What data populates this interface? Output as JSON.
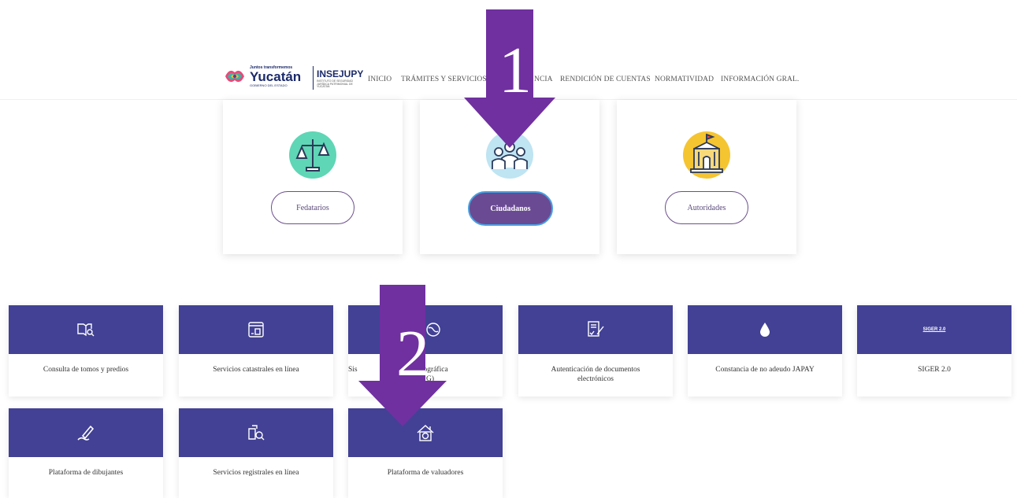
{
  "header": {
    "logo": {
      "tagline": "Juntos transformemos",
      "name": "Yucatán",
      "subtitle": "GOBIERNO DEL ESTADO",
      "org": "INSEJUPY",
      "org_subtitle": "INSTITUTO DE SEGURIDAD JURÍDICA PATRIMONIAL DE YUCATÁN"
    },
    "nav": [
      {
        "label": "INICIO"
      },
      {
        "label": "TRÁMITES Y SERVICIOS"
      },
      {
        "label": "NCIA"
      },
      {
        "label": "RENDICIÓN DE CUENTAS"
      },
      {
        "label": "NORMATIVIDAD"
      },
      {
        "label": "INFORMACIÓN GRAL."
      }
    ]
  },
  "profiles": [
    {
      "label": "Fedatarios",
      "icon": "scales-icon",
      "active": false
    },
    {
      "label": "Ciudadanos",
      "icon": "citizens-icon",
      "active": true
    },
    {
      "label": "Autoridades",
      "icon": "government-building-icon",
      "active": false
    }
  ],
  "services": [
    {
      "label": "Consulta de tomos y predios",
      "icon": "book-search-icon"
    },
    {
      "label": "Servicios catastrales en línea",
      "icon": "online-document-icon"
    },
    {
      "label": "Sis",
      "label2": "ación geográfica",
      "label3": "G)",
      "icon": "globe-icon"
    },
    {
      "label": "Autenticación de documentos electrónicos",
      "icon": "signed-document-icon"
    },
    {
      "label": "Constancia de no adeudo JAPAY",
      "icon": "water-drop-icon"
    },
    {
      "label": "SIGER 2.0",
      "icon_text": "SIGER 2.0",
      "icon": "siger-logo-icon"
    },
    {
      "label": "Plataforma de dibujantes",
      "icon": "pencil-icon"
    },
    {
      "label": "Servicios registrales en línea",
      "icon": "registry-search-icon"
    },
    {
      "label": "Plataforma de valuadores",
      "icon": "house-valuation-icon"
    }
  ],
  "annotations": [
    {
      "number": "1"
    },
    {
      "number": "2"
    }
  ],
  "colors": {
    "tile_header": "#424195",
    "arrow": "#7030a0",
    "active_button": "#6a4a93"
  }
}
